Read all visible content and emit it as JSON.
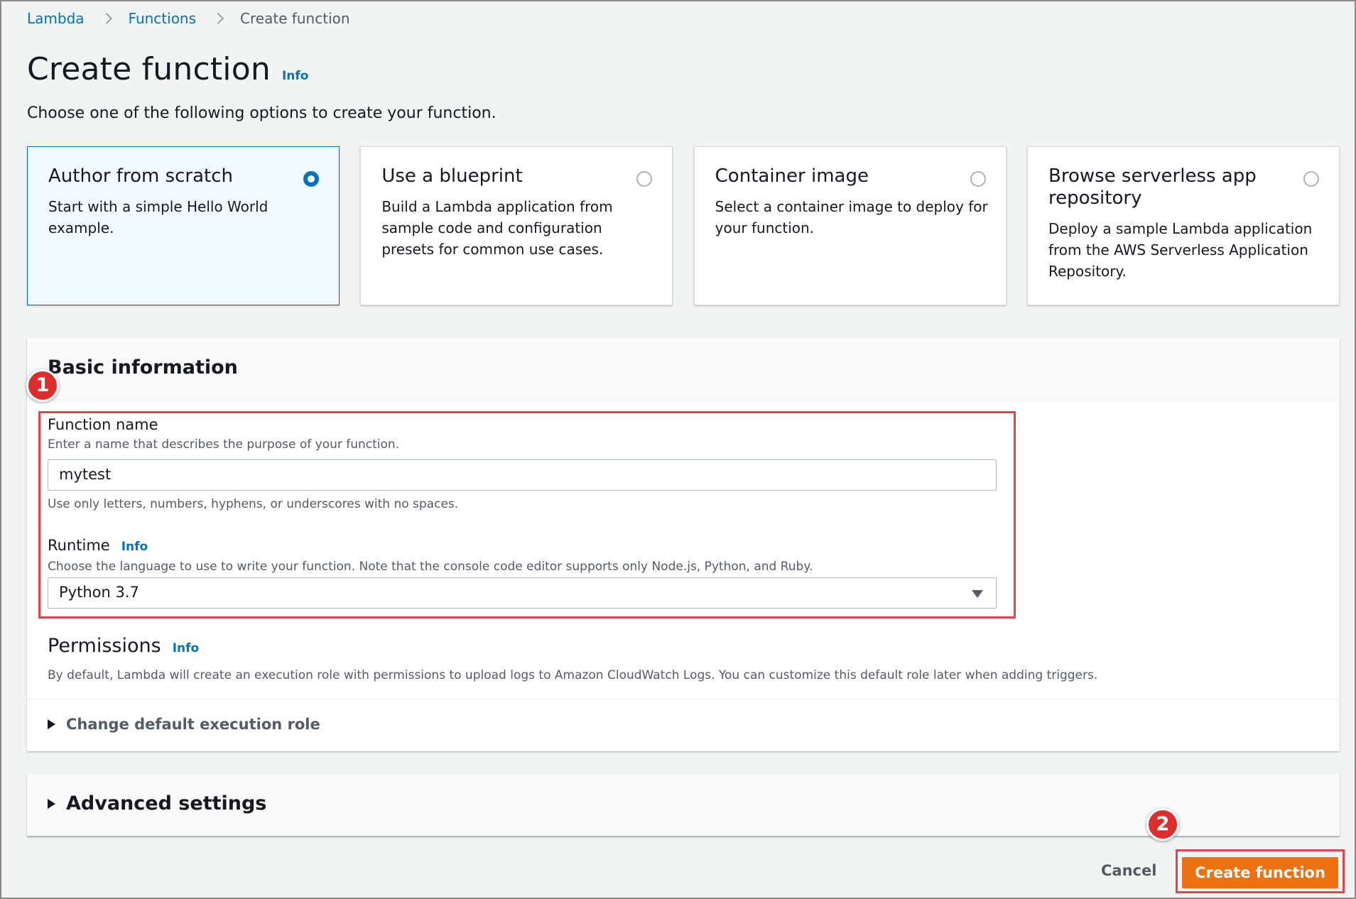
{
  "breadcrumb": {
    "lambda": "Lambda",
    "functions": "Functions",
    "current": "Create function"
  },
  "header": {
    "title": "Create function",
    "info": "Info",
    "description": "Choose one of the following options to create your function."
  },
  "options": [
    {
      "title": "Author from scratch",
      "description": "Start with a simple Hello World example.",
      "selected": true
    },
    {
      "title": "Use a blueprint",
      "description": "Build a Lambda application from sample code and configuration presets for common use cases.",
      "selected": false
    },
    {
      "title": "Container image",
      "description": "Select a container image to deploy for your function.",
      "selected": false
    },
    {
      "title": "Browse serverless app repository",
      "description": "Deploy a sample Lambda application from the AWS Serverless Application Repository.",
      "selected": false
    }
  ],
  "basic_info": {
    "title": "Basic information",
    "function_name": {
      "label": "Function name",
      "description": "Enter a name that describes the purpose of your function.",
      "value": "mytest",
      "constraint": "Use only letters, numbers, hyphens, or underscores with no spaces."
    },
    "runtime": {
      "label": "Runtime",
      "info": "Info",
      "description": "Choose the language to use to write your function. Note that the console code editor supports only Node.js, Python, and Ruby.",
      "value": "Python 3.7"
    },
    "permissions": {
      "label": "Permissions",
      "info": "Info",
      "description": "By default, Lambda will create an execution role with permissions to upload logs to Amazon CloudWatch Logs. You can customize this default role later when adding triggers."
    },
    "change_role": "Change default execution role"
  },
  "advanced": {
    "label": "Advanced settings"
  },
  "actions": {
    "cancel": "Cancel",
    "create": "Create function"
  },
  "annotations": {
    "step1": "1",
    "step2": "2"
  },
  "colors": {
    "accent": "#0073bb",
    "primary_button": "#ec7211",
    "annotation": "#e0454f"
  }
}
